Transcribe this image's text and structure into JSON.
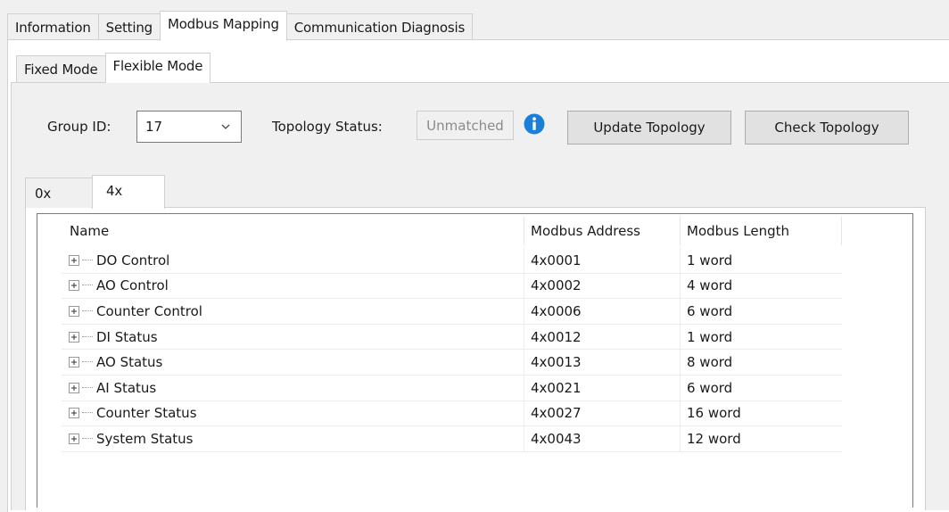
{
  "main_tabs": [
    {
      "label": "Information",
      "active": false
    },
    {
      "label": "Setting",
      "active": false
    },
    {
      "label": "Modbus Mapping",
      "active": true
    },
    {
      "label": "Communication Diagnosis",
      "active": false
    }
  ],
  "mode_tabs": [
    {
      "label": "Fixed Mode",
      "active": false
    },
    {
      "label": "Flexible Mode",
      "active": true
    }
  ],
  "group": {
    "label": "Group ID:",
    "value": "17"
  },
  "topology": {
    "label": "Topology Status:",
    "value": "Unmatched"
  },
  "buttons": {
    "update": "Update Topology",
    "check": "Check Topology"
  },
  "register_tabs": [
    {
      "label": "0x",
      "active": false
    },
    {
      "label": "4x",
      "active": true
    }
  ],
  "table": {
    "columns": [
      "Name",
      "Modbus Address",
      "Modbus Length"
    ],
    "rows": [
      {
        "name": "DO Control",
        "address": "4x0001",
        "length": "1 word"
      },
      {
        "name": "AO Control",
        "address": "4x0002",
        "length": "4 word"
      },
      {
        "name": "Counter Control",
        "address": "4x0006",
        "length": "6 word"
      },
      {
        "name": "DI Status",
        "address": "4x0012",
        "length": "1 word"
      },
      {
        "name": "AO Status",
        "address": "4x0013",
        "length": "8 word"
      },
      {
        "name": "AI Status",
        "address": "4x0021",
        "length": "6 word"
      },
      {
        "name": "Counter Status",
        "address": "4x0027",
        "length": "16 word"
      },
      {
        "name": "System Status",
        "address": "4x0043",
        "length": "12 word"
      }
    ]
  },
  "colors": {
    "accent": "#1a7fd6",
    "border": "#7a7a7a",
    "panel": "#f0f0f0"
  },
  "icons": {
    "info": "info-circle-icon",
    "combo": "chevron-down-icon",
    "expander": "plus-box-icon"
  }
}
